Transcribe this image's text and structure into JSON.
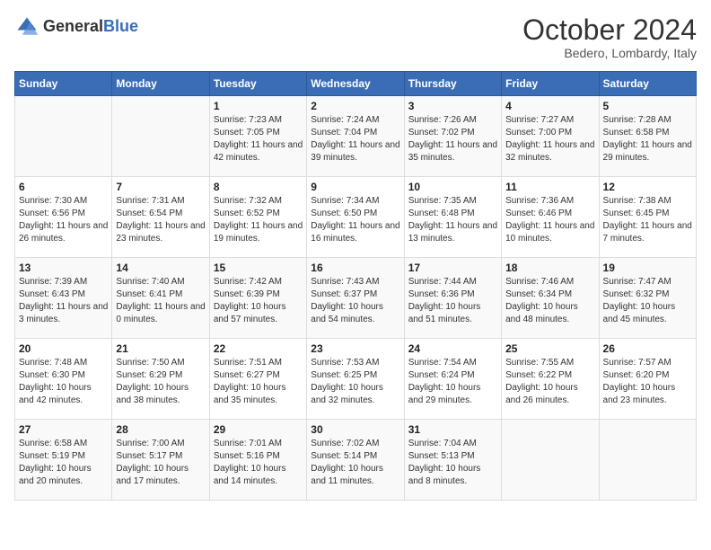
{
  "header": {
    "logo_general": "General",
    "logo_blue": "Blue",
    "title": "October 2024",
    "subtitle": "Bedero, Lombardy, Italy"
  },
  "weekdays": [
    "Sunday",
    "Monday",
    "Tuesday",
    "Wednesday",
    "Thursday",
    "Friday",
    "Saturday"
  ],
  "weeks": [
    [
      {
        "day": "",
        "sunrise": "",
        "sunset": "",
        "daylight": ""
      },
      {
        "day": "",
        "sunrise": "",
        "sunset": "",
        "daylight": ""
      },
      {
        "day": "1",
        "sunrise": "Sunrise: 7:23 AM",
        "sunset": "Sunset: 7:05 PM",
        "daylight": "Daylight: 11 hours and 42 minutes."
      },
      {
        "day": "2",
        "sunrise": "Sunrise: 7:24 AM",
        "sunset": "Sunset: 7:04 PM",
        "daylight": "Daylight: 11 hours and 39 minutes."
      },
      {
        "day": "3",
        "sunrise": "Sunrise: 7:26 AM",
        "sunset": "Sunset: 7:02 PM",
        "daylight": "Daylight: 11 hours and 35 minutes."
      },
      {
        "day": "4",
        "sunrise": "Sunrise: 7:27 AM",
        "sunset": "Sunset: 7:00 PM",
        "daylight": "Daylight: 11 hours and 32 minutes."
      },
      {
        "day": "5",
        "sunrise": "Sunrise: 7:28 AM",
        "sunset": "Sunset: 6:58 PM",
        "daylight": "Daylight: 11 hours and 29 minutes."
      }
    ],
    [
      {
        "day": "6",
        "sunrise": "Sunrise: 7:30 AM",
        "sunset": "Sunset: 6:56 PM",
        "daylight": "Daylight: 11 hours and 26 minutes."
      },
      {
        "day": "7",
        "sunrise": "Sunrise: 7:31 AM",
        "sunset": "Sunset: 6:54 PM",
        "daylight": "Daylight: 11 hours and 23 minutes."
      },
      {
        "day": "8",
        "sunrise": "Sunrise: 7:32 AM",
        "sunset": "Sunset: 6:52 PM",
        "daylight": "Daylight: 11 hours and 19 minutes."
      },
      {
        "day": "9",
        "sunrise": "Sunrise: 7:34 AM",
        "sunset": "Sunset: 6:50 PM",
        "daylight": "Daylight: 11 hours and 16 minutes."
      },
      {
        "day": "10",
        "sunrise": "Sunrise: 7:35 AM",
        "sunset": "Sunset: 6:48 PM",
        "daylight": "Daylight: 11 hours and 13 minutes."
      },
      {
        "day": "11",
        "sunrise": "Sunrise: 7:36 AM",
        "sunset": "Sunset: 6:46 PM",
        "daylight": "Daylight: 11 hours and 10 minutes."
      },
      {
        "day": "12",
        "sunrise": "Sunrise: 7:38 AM",
        "sunset": "Sunset: 6:45 PM",
        "daylight": "Daylight: 11 hours and 7 minutes."
      }
    ],
    [
      {
        "day": "13",
        "sunrise": "Sunrise: 7:39 AM",
        "sunset": "Sunset: 6:43 PM",
        "daylight": "Daylight: 11 hours and 3 minutes."
      },
      {
        "day": "14",
        "sunrise": "Sunrise: 7:40 AM",
        "sunset": "Sunset: 6:41 PM",
        "daylight": "Daylight: 11 hours and 0 minutes."
      },
      {
        "day": "15",
        "sunrise": "Sunrise: 7:42 AM",
        "sunset": "Sunset: 6:39 PM",
        "daylight": "Daylight: 10 hours and 57 minutes."
      },
      {
        "day": "16",
        "sunrise": "Sunrise: 7:43 AM",
        "sunset": "Sunset: 6:37 PM",
        "daylight": "Daylight: 10 hours and 54 minutes."
      },
      {
        "day": "17",
        "sunrise": "Sunrise: 7:44 AM",
        "sunset": "Sunset: 6:36 PM",
        "daylight": "Daylight: 10 hours and 51 minutes."
      },
      {
        "day": "18",
        "sunrise": "Sunrise: 7:46 AM",
        "sunset": "Sunset: 6:34 PM",
        "daylight": "Daylight: 10 hours and 48 minutes."
      },
      {
        "day": "19",
        "sunrise": "Sunrise: 7:47 AM",
        "sunset": "Sunset: 6:32 PM",
        "daylight": "Daylight: 10 hours and 45 minutes."
      }
    ],
    [
      {
        "day": "20",
        "sunrise": "Sunrise: 7:48 AM",
        "sunset": "Sunset: 6:30 PM",
        "daylight": "Daylight: 10 hours and 42 minutes."
      },
      {
        "day": "21",
        "sunrise": "Sunrise: 7:50 AM",
        "sunset": "Sunset: 6:29 PM",
        "daylight": "Daylight: 10 hours and 38 minutes."
      },
      {
        "day": "22",
        "sunrise": "Sunrise: 7:51 AM",
        "sunset": "Sunset: 6:27 PM",
        "daylight": "Daylight: 10 hours and 35 minutes."
      },
      {
        "day": "23",
        "sunrise": "Sunrise: 7:53 AM",
        "sunset": "Sunset: 6:25 PM",
        "daylight": "Daylight: 10 hours and 32 minutes."
      },
      {
        "day": "24",
        "sunrise": "Sunrise: 7:54 AM",
        "sunset": "Sunset: 6:24 PM",
        "daylight": "Daylight: 10 hours and 29 minutes."
      },
      {
        "day": "25",
        "sunrise": "Sunrise: 7:55 AM",
        "sunset": "Sunset: 6:22 PM",
        "daylight": "Daylight: 10 hours and 26 minutes."
      },
      {
        "day": "26",
        "sunrise": "Sunrise: 7:57 AM",
        "sunset": "Sunset: 6:20 PM",
        "daylight": "Daylight: 10 hours and 23 minutes."
      }
    ],
    [
      {
        "day": "27",
        "sunrise": "Sunrise: 6:58 AM",
        "sunset": "Sunset: 5:19 PM",
        "daylight": "Daylight: 10 hours and 20 minutes."
      },
      {
        "day": "28",
        "sunrise": "Sunrise: 7:00 AM",
        "sunset": "Sunset: 5:17 PM",
        "daylight": "Daylight: 10 hours and 17 minutes."
      },
      {
        "day": "29",
        "sunrise": "Sunrise: 7:01 AM",
        "sunset": "Sunset: 5:16 PM",
        "daylight": "Daylight: 10 hours and 14 minutes."
      },
      {
        "day": "30",
        "sunrise": "Sunrise: 7:02 AM",
        "sunset": "Sunset: 5:14 PM",
        "daylight": "Daylight: 10 hours and 11 minutes."
      },
      {
        "day": "31",
        "sunrise": "Sunrise: 7:04 AM",
        "sunset": "Sunset: 5:13 PM",
        "daylight": "Daylight: 10 hours and 8 minutes."
      },
      {
        "day": "",
        "sunrise": "",
        "sunset": "",
        "daylight": ""
      },
      {
        "day": "",
        "sunrise": "",
        "sunset": "",
        "daylight": ""
      }
    ]
  ]
}
